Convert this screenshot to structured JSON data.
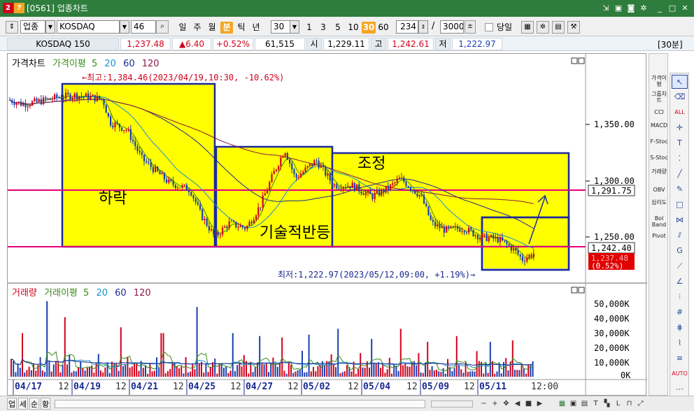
{
  "titlebar": {
    "icon_a": "2",
    "icon_b": "?",
    "title": "[0561] 업종차트",
    "buttons": [
      "pin-icon",
      "save-icon",
      "camera-icon",
      "gear-icon",
      "minimize-icon",
      "maximize-icon",
      "close-icon"
    ]
  },
  "toolbar": {
    "market": "업종",
    "index": "KOSDAQ",
    "code": "46",
    "periods": [
      "일",
      "주",
      "월",
      "분",
      "틱",
      "년"
    ],
    "active_period": "분",
    "interval": "30",
    "quick_intervals": [
      "1",
      "3",
      "5",
      "10",
      "30",
      "60"
    ],
    "active_interval": "30",
    "count": "234",
    "total": "3000",
    "today_label": "당일"
  },
  "inforow": {
    "name": "KOSDAQ 150",
    "price": "1,237.48",
    "change": "▲6.40",
    "change_pct": "+0.52%",
    "volume": "61,515",
    "open_label": "시",
    "open": "1,229.11",
    "high_label": "고",
    "high": "1,242.61",
    "low_label": "저",
    "low": "1,222.97",
    "interval_tag": "[30분]"
  },
  "price_panel": {
    "legend_title": "가격차트",
    "legend_ma_label": "가격이평",
    "legend_ma": [
      "5",
      "20",
      "60",
      "120"
    ],
    "max_note": "←최고:1,384.46(2023/04/19,10:30, -10.62%)",
    "min_note": "최저:1,222.97(2023/05/12,09:00, +1.19%)→",
    "y_ticks": [
      "1,350.00",
      "1,300.00",
      "1,250.00"
    ],
    "line_upper_label": "1,291.75",
    "line_lower_label": "1,242.40",
    "current_price": "1,237.48",
    "current_pct": "(0.52%)",
    "annotations": [
      "하락",
      "기술적반등",
      "조정"
    ]
  },
  "volume_panel": {
    "legend_title": "거래량",
    "legend_ma_label": "거래이평",
    "legend_ma": [
      "5",
      "20",
      "60",
      "120"
    ],
    "y_ticks": [
      "50,000K",
      "40,000K",
      "30,000K",
      "20,000K",
      "10,000K",
      "0K"
    ]
  },
  "x_axis": {
    "labels": [
      "04/17",
      "12",
      "04/19",
      "12",
      "04/21",
      "12",
      "04/25",
      "12",
      "04/27",
      "12",
      "05/02",
      "12",
      "05/04",
      "12",
      "05/09",
      "12",
      "05/11",
      "12:00"
    ]
  },
  "sidebar": {
    "items": [
      "가격이평",
      "그룹차트",
      "CCI",
      "MACD",
      "F-Stoc",
      "S-Stoc",
      "거래량",
      "OBV",
      "심리도",
      "Bol Band",
      "Pivot"
    ]
  },
  "bottom": {
    "tabs": [
      "업",
      "세",
      "순",
      "황"
    ]
  },
  "colors": {
    "title_green": "#2e7d3c",
    "box_yellow": "#ffff00",
    "box_border": "#1c2a9e",
    "hline": "#e6007e",
    "up_candle": "#d0021b",
    "down_candle": "#1a3fb0",
    "ma5": "#3a8a1a",
    "ma20": "#1a8fd0",
    "ma60": "#1a2a90",
    "ma120": "#8a1a4a"
  }
}
